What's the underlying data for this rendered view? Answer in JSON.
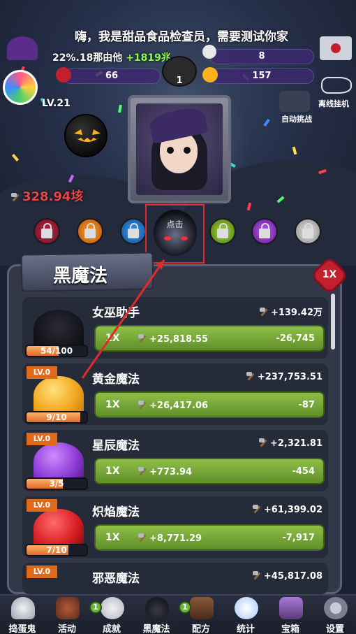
{
  "header": {
    "message": "嗨，我是甜品食品检查员，需要测试你家",
    "stat_overlay_prefix": "22%.18",
    "stat_overlay_mid": "那由他",
    "stat_overlay_green": "+1819兆",
    "skull_count": "8",
    "potion_count": "66",
    "cauldron_count": "1",
    "candy_count": "157",
    "level": "LV.21",
    "damage_value": "328.94垓",
    "auto_battle": "自动挑战",
    "offline_idle": "离线挂机"
  },
  "selected_tab_hint": "点击",
  "panel": {
    "title": "黑魔法",
    "multiplier": "1X"
  },
  "items": [
    {
      "name": "女巫助手",
      "reward": "+139.42万",
      "level": "",
      "progress": "54/100",
      "progress_fraction": 0.54,
      "buy_mult": "1X",
      "buy_gain": "+25,818.55",
      "buy_cost": "-26,745",
      "color": "#1a1a22"
    },
    {
      "name": "黄金魔法",
      "reward": "+237,753.51",
      "level": "LV.0",
      "progress": "9/10",
      "progress_fraction": 0.9,
      "buy_mult": "1X",
      "buy_gain": "+26,417.06",
      "buy_cost": "-87",
      "color": "#f2a41c"
    },
    {
      "name": "星辰魔法",
      "reward": "+2,321.81",
      "level": "LV.0",
      "progress": "3/5",
      "progress_fraction": 0.6,
      "buy_mult": "1X",
      "buy_gain": "+773.94",
      "buy_cost": "-454",
      "color": "#8d3ad6"
    },
    {
      "name": "炽焰魔法",
      "reward": "+61,399.02",
      "level": "LV.0",
      "progress": "7/10",
      "progress_fraction": 0.7,
      "buy_mult": "1X",
      "buy_gain": "+8,771.29",
      "buy_cost": "-7,917",
      "color": "#d81e24"
    },
    {
      "name": "邪恶魔法",
      "reward": "+45,817.08",
      "level": "LV.0",
      "color": "#2d3a2a"
    }
  ],
  "nav": [
    {
      "label": "捣蛋鬼",
      "icon": "ghost-icon",
      "badge": ""
    },
    {
      "label": "活动",
      "icon": "cupcake-icon",
      "badge": ""
    },
    {
      "label": "成就",
      "icon": "skull-icon",
      "badge": "1"
    },
    {
      "label": "黑魔法",
      "icon": "demon-icon",
      "badge": ""
    },
    {
      "label": "配方",
      "icon": "book-icon",
      "badge": "1"
    },
    {
      "label": "统计",
      "icon": "crystal-ball-icon",
      "badge": ""
    },
    {
      "label": "宝箱",
      "icon": "chest-icon",
      "badge": ""
    },
    {
      "label": "设置",
      "icon": "gear-icon",
      "badge": ""
    }
  ],
  "colors": {
    "accent_red": "#e32a2a",
    "button_green": "#7aa83a",
    "panel": "#333848"
  }
}
